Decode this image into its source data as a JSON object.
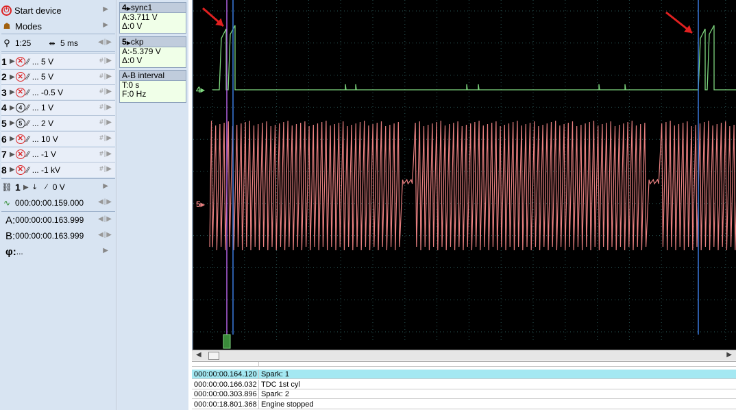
{
  "menu": {
    "start_device": "Start device",
    "modes": "Modes"
  },
  "timebase": {
    "zoom": "1:25",
    "time_div": "5 ms"
  },
  "channels": [
    {
      "num": "1",
      "icon": "x",
      "value": "... 5 V"
    },
    {
      "num": "2",
      "icon": "x",
      "value": "... 5 V"
    },
    {
      "num": "3",
      "icon": "x",
      "value": "... -0.5 V"
    },
    {
      "num": "4",
      "icon": "4",
      "value": "... 1 V"
    },
    {
      "num": "5",
      "icon": "5",
      "value": "... 2 V"
    },
    {
      "num": "6",
      "icon": "x",
      "value": "... 10 V"
    },
    {
      "num": "7",
      "icon": "x",
      "value": "... -1 V"
    },
    {
      "num": "8",
      "icon": "x",
      "value": "... -1 kV"
    }
  ],
  "trigger": {
    "channel": "1",
    "level": "0 V",
    "position": "000:00:00.159.000"
  },
  "cursors": {
    "a": "000:00:00.163.999",
    "b": "000:00:00.163.999",
    "phi": "...",
    "a_label": "A:",
    "b_label": "B:",
    "phi_label": "φ:"
  },
  "measure": {
    "ch4_head": "sync1",
    "ch4_a": "A:3.711 V",
    "ch4_delta": "Δ:0 V",
    "ch5_head": "ckp",
    "ch5_a": "A:-5.379 V",
    "ch5_delta": "Δ:0 V",
    "ab_head": "A-B interval",
    "ab_t": "T:0 s",
    "ab_f": "F:0 Hz"
  },
  "traces": {
    "ch4_label": "4",
    "ch5_label": "5",
    "ch4_color": "#7fd87f",
    "ch5_color": "#e88080",
    "grid_color": "#2c5a5a",
    "cursor_a_color": "#b060e0",
    "cursor_b_color": "#3a7adf",
    "arrow_color": "#e02020"
  },
  "events": [
    {
      "time": "000:00:00.164.120",
      "desc": "Spark: 1",
      "selected": true
    },
    {
      "time": "000:00:00.166.032",
      "desc": "TDC 1st cyl",
      "selected": false
    },
    {
      "time": "000:00:00.303.896",
      "desc": "Spark: 2",
      "selected": false
    },
    {
      "time": "000:00:18.801.368",
      "desc": "Engine stopped",
      "selected": false
    }
  ]
}
